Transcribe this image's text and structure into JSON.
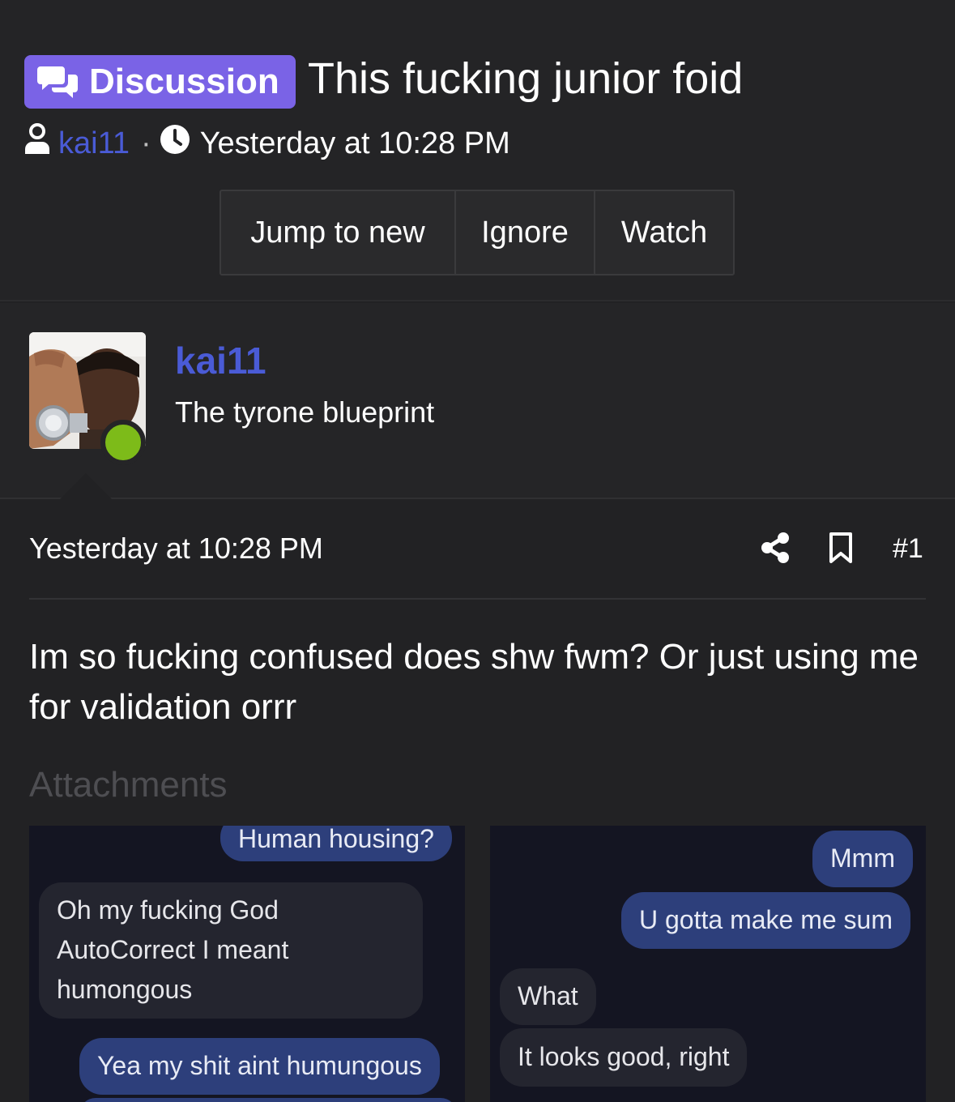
{
  "thread": {
    "badge_label": "Discussion",
    "title": "This fucking junior foid",
    "author": "kai11",
    "separator": "·",
    "timestamp": "Yesterday at 10:28 PM",
    "accent_color": "#7a63e6"
  },
  "actions": {
    "jump_label": "Jump to new",
    "ignore_label": "Ignore",
    "watch_label": "Watch"
  },
  "poster": {
    "name": "kai11",
    "user_title": "The tyrone blueprint",
    "status": "online",
    "name_color": "#4a5bd6"
  },
  "post": {
    "date": "Yesterday at 10:28 PM",
    "number": "#1",
    "body": "Im so fucking confused does shw fwm? Or just using me for validation orrr",
    "attachments_heading": "Attachments"
  },
  "attachments": [
    {
      "messages": [
        {
          "text": "Human housing?",
          "side": "sent"
        },
        {
          "text": "Oh my fucking God",
          "side": "received"
        },
        {
          "text": "AutoCorrect I meant",
          "side": "received"
        },
        {
          "text": "humongous",
          "side": "received"
        },
        {
          "text": "Yea my shit aint humungous",
          "side": "sent"
        }
      ]
    },
    {
      "messages": [
        {
          "text": "Mmm",
          "side": "sent"
        },
        {
          "text": "U gotta make me sum",
          "side": "sent"
        },
        {
          "text": "What",
          "side": "received"
        },
        {
          "text": "It looks good, right",
          "side": "received"
        }
      ]
    }
  ],
  "icons": {
    "badge": "chat-bubbles-icon",
    "author": "user-icon",
    "time": "clock-icon",
    "share": "share-icon",
    "bookmark": "bookmark-icon"
  }
}
